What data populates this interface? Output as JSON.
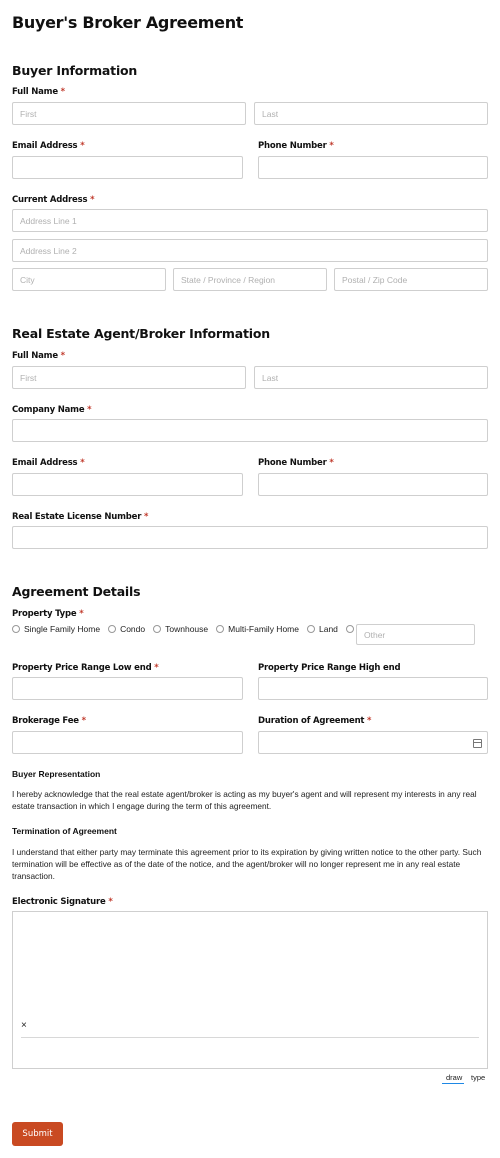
{
  "form": {
    "title": "Buyer's Broker Agreement",
    "required_mark": "*"
  },
  "buyer": {
    "section_title": "Buyer Information",
    "full_name_label": "Full Name",
    "first_placeholder": "First",
    "last_placeholder": "Last",
    "email_label": "Email Address",
    "phone_label": "Phone Number",
    "address_label": "Current Address",
    "address1_placeholder": "Address Line 1",
    "address2_placeholder": "Address Line 2",
    "city_placeholder": "City",
    "state_placeholder": "State / Province / Region",
    "zip_placeholder": "Postal / Zip Code"
  },
  "agent": {
    "section_title": "Real Estate Agent/Broker Information",
    "full_name_label": "Full Name",
    "first_placeholder": "First",
    "last_placeholder": "Last",
    "company_label": "Company Name",
    "email_label": "Email Address",
    "phone_label": "Phone Number",
    "license_label": "Real Estate License Number"
  },
  "agreement": {
    "section_title": "Agreement Details",
    "property_type_label": "Property Type",
    "property_types": [
      "Single Family Home",
      "Condo",
      "Townhouse",
      "Multi-Family Home",
      "Land"
    ],
    "other_placeholder": "Other",
    "price_low_label": "Property Price Range Low end",
    "price_high_label": "Property Price Range High end",
    "fee_label": "Brokerage Fee",
    "duration_label": "Duration of Agreement",
    "representation_heading": "Buyer Representation",
    "representation_text": "I hereby acknowledge that the real estate agent/broker is acting as my buyer's agent and will represent my interests in any real estate transaction in which I engage during the term of this agreement.",
    "termination_heading": "Termination of Agreement",
    "termination_text": "I understand that either party may terminate this agreement prior to its expiration by giving written notice to the other party. Such termination will be effective as of the date of the notice, and the agent/broker will no longer represent me in any real estate transaction.",
    "signature_label": "Electronic Signature",
    "signature_x": "×",
    "tab_draw": "draw",
    "tab_type": "type"
  },
  "submit_label": "Submit",
  "colors": {
    "accent": "#c94a22",
    "required": "#c0392b",
    "tab_active": "#1e88e5"
  }
}
